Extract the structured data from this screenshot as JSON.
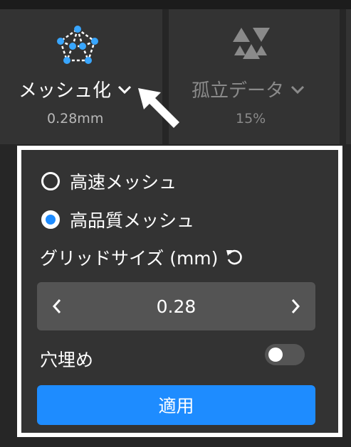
{
  "toolbar": {
    "mesh": {
      "label": "メッシュ化",
      "value": "0.28mm",
      "icon": "mesh-network-icon",
      "dropdown_icon": "chevron-down-icon"
    },
    "isolated": {
      "label": "孤立データ",
      "value": "15%",
      "icon": "triangles-icon",
      "dropdown_icon": "chevron-down-icon"
    }
  },
  "panel": {
    "options": [
      {
        "label": "高速メッシュ",
        "selected": false
      },
      {
        "label": "高品質メッシュ",
        "selected": true
      }
    ],
    "grid_size_label": "グリッドサイズ (mm)",
    "grid_size_value": "0.28",
    "fill_holes_label": "穴埋め",
    "fill_holes_on": false,
    "apply_label": "適用"
  },
  "colors": {
    "accent": "#1e8cff",
    "panel_bg": "#333333",
    "stepper_bg": "#545454"
  }
}
